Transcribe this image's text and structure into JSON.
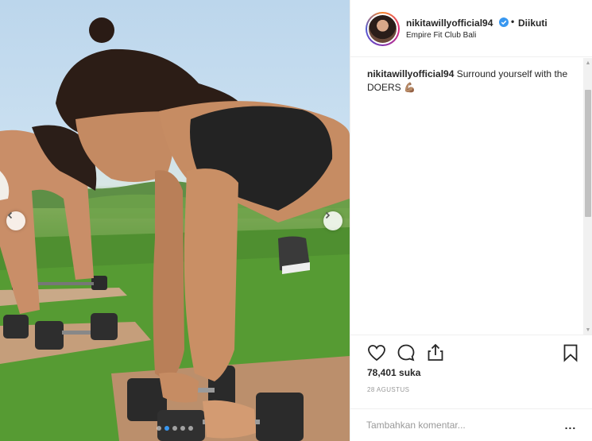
{
  "post": {
    "username": "nikitawillyofficial94",
    "separator": "•",
    "following_label": "Diikuti",
    "location": "Empire Fit Club Bali",
    "caption_user": "nikitawillyofficial94",
    "caption_text": "Surround yourself with the DOERS",
    "caption_emoji": "💪🏽",
    "likes": "78,401 suka",
    "date": "28 AGUSTUS",
    "comment_placeholder": "Tambahkan komentar...",
    "more_label": "..."
  },
  "carousel": {
    "slides": 5,
    "active_index": 1
  },
  "icons": {
    "like": "heart-icon",
    "comment": "comment-icon",
    "share": "share-icon",
    "save": "bookmark-icon",
    "verified": "verified-badge-icon",
    "prev": "chevron-left-icon",
    "next": "chevron-right-icon"
  },
  "colors": {
    "verified_blue": "#3897f0",
    "text": "#262626",
    "muted": "#999999",
    "border": "#efefef"
  }
}
